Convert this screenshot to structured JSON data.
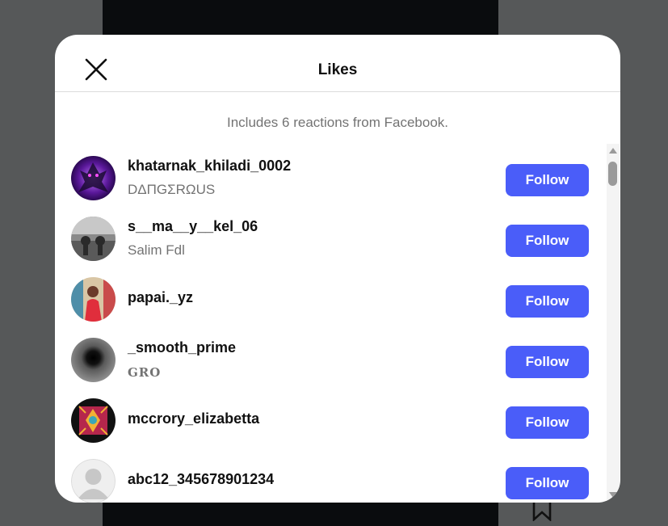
{
  "modal": {
    "title": "Likes",
    "notice": "Includes 6 reactions from Facebook."
  },
  "likes": [
    {
      "username": "khatarnak_khiladi_0002",
      "full_name": "DΔΠGΣRΩUS",
      "button": "Follow"
    },
    {
      "username": "s__ma__y__kel_06",
      "full_name": "Salim Fdl",
      "button": "Follow"
    },
    {
      "username": "papai._yz",
      "full_name": "",
      "button": "Follow"
    },
    {
      "username": "_smooth_prime",
      "full_name": "GRO",
      "button": "Follow"
    },
    {
      "username": "mccrory_elizabetta",
      "full_name": "",
      "button": "Follow"
    },
    {
      "username": "abc12_345678901234",
      "full_name": "",
      "button": "Follow"
    }
  ],
  "icons": {
    "close": "close-icon",
    "bookmark": "bookmark-icon",
    "default_avatar": "default-avatar-icon"
  },
  "colors": {
    "follow_button": "#4a5df9",
    "overlay": "#565859",
    "secondary_text": "#737373"
  }
}
